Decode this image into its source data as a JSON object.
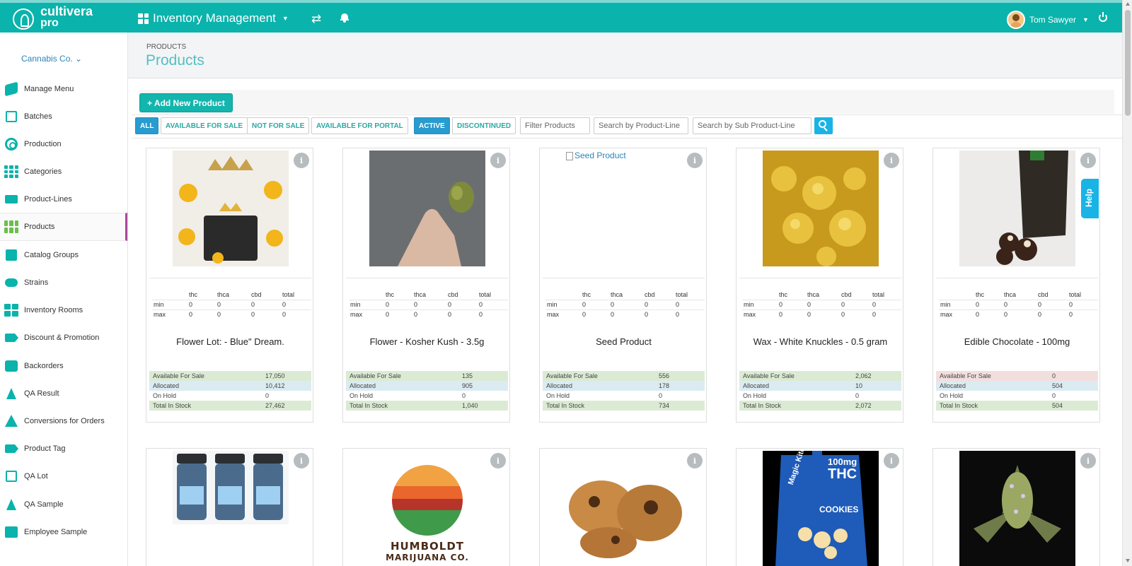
{
  "app": {
    "brand_line1": "cultivera",
    "brand_line2": "pro",
    "module_title": "Inventory Management",
    "user_name": "Tom Sawyer"
  },
  "sidebar": {
    "company": "Cannabis Co. ⌄",
    "items": [
      {
        "label": "Manage Menu",
        "icon": "menu-icon"
      },
      {
        "label": "Batches",
        "icon": "batches-icon"
      },
      {
        "label": "Production",
        "icon": "production-icon"
      },
      {
        "label": "Categories",
        "icon": "categories-icon"
      },
      {
        "label": "Product-Lines",
        "icon": "product-lines-icon"
      },
      {
        "label": "Products",
        "icon": "products-icon",
        "active": true
      },
      {
        "label": "Catalog Groups",
        "icon": "catalog-icon"
      },
      {
        "label": "Strains",
        "icon": "strains-icon"
      },
      {
        "label": "Inventory Rooms",
        "icon": "rooms-icon"
      },
      {
        "label": "Discount & Promotion",
        "icon": "discount-icon"
      },
      {
        "label": "Backorders",
        "icon": "backorders-icon"
      },
      {
        "label": "QA Result",
        "icon": "flask-icon"
      },
      {
        "label": "Conversions for Orders",
        "icon": "recycle-icon"
      },
      {
        "label": "Product Tag",
        "icon": "tag-icon"
      },
      {
        "label": "QA Lot",
        "icon": "qa-lot-icon"
      },
      {
        "label": "QA Sample",
        "icon": "flask-icon"
      },
      {
        "label": "Employee Sample",
        "icon": "employee-icon"
      }
    ]
  },
  "header": {
    "breadcrumb": "PRODUCTS",
    "title": "Products"
  },
  "toolbar": {
    "add_label": "+ Add New Product"
  },
  "filters": {
    "all": "ALL",
    "available_for_sale": "AVAILABLE FOR SALE",
    "not_for_sale": "NOT FOR SALE",
    "available_for_portal": "AVAILABLE FOR PORTAL",
    "active": "ACTIVE",
    "discontinued": "DISCONTINUED",
    "filter_placeholder": "Filter Products",
    "product_line_placeholder": "Search by Product-Line",
    "sub_product_line_placeholder": "Search by Sub Product-Line"
  },
  "potency_headers": {
    "thc": "thc",
    "thca": "thca",
    "cbd": "cbd",
    "total": "total",
    "min": "min",
    "max": "max"
  },
  "stock_labels": {
    "available": "Available For Sale",
    "allocated": "Allocated",
    "on_hold": "On Hold",
    "total": "Total In Stock"
  },
  "products": [
    {
      "name": "Flower Lot: - Blue\" Dream.",
      "min": [
        "0",
        "0",
        "0",
        "0"
      ],
      "max": [
        "0",
        "0",
        "0",
        "0"
      ],
      "available": "17,050",
      "allocated": "10,412",
      "on_hold": "0",
      "total": "27,462"
    },
    {
      "name": "Flower - Kosher Kush - 3.5g",
      "min": [
        "0",
        "0",
        "0",
        "0"
      ],
      "max": [
        "0",
        "0",
        "0",
        "0"
      ],
      "available": "135",
      "allocated": "905",
      "on_hold": "0",
      "total": "1,040"
    },
    {
      "name": "Seed Product",
      "alt_text": "Seed Product",
      "min": [
        "0",
        "0",
        "0",
        "0"
      ],
      "max": [
        "0",
        "0",
        "0",
        "0"
      ],
      "available": "556",
      "allocated": "178",
      "on_hold": "0",
      "total": "734"
    },
    {
      "name": "Wax - White Knuckles - 0.5 gram",
      "min": [
        "0",
        "0",
        "0",
        "0"
      ],
      "max": [
        "0",
        "0",
        "0",
        "0"
      ],
      "available": "2,062",
      "allocated": "10",
      "on_hold": "0",
      "total": "2,072"
    },
    {
      "name": "Edible Chocolate - 100mg",
      "min": [
        "0",
        "0",
        "0",
        "0"
      ],
      "max": [
        "0",
        "0",
        "0",
        "0"
      ],
      "available": "0",
      "allocated": "504",
      "on_hold": "0",
      "total": "504"
    }
  ],
  "second_row": {
    "humboldt_line1": "HUMBOLDT",
    "humboldt_line2": "MARIJUANA CO.",
    "cookie_box_line1": "100mg",
    "cookie_box_line2": "THC",
    "cookie_box_brand": "Magic Kitchen",
    "cookie_box_label": "COOKIES"
  },
  "help_label": "Help"
}
